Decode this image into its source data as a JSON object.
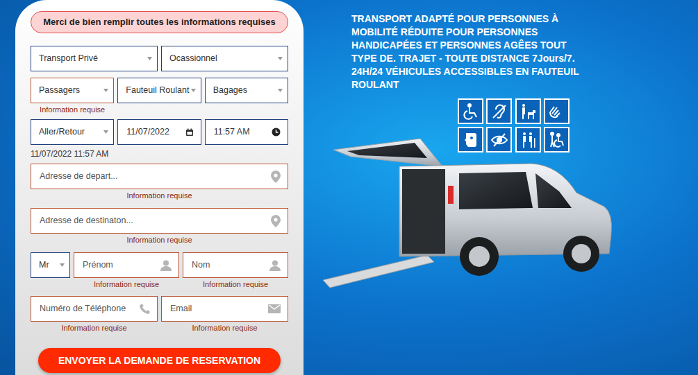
{
  "notice": "Merci de bien remplir toutes les informations requises",
  "form": {
    "rows": [
      {
        "fields": [
          {
            "kind": "select",
            "value": "Transport Privé",
            "error": false
          },
          {
            "kind": "select",
            "value": "Ocassionnel",
            "error": false
          }
        ]
      },
      {
        "fields": [
          {
            "kind": "select",
            "value": "Passagers",
            "error": true,
            "message": "Information requise"
          },
          {
            "kind": "select",
            "value": "Fauteuil Roulant",
            "error": false
          },
          {
            "kind": "select",
            "value": "Bagages",
            "error": false
          }
        ]
      },
      {
        "fields": [
          {
            "kind": "select",
            "value": "Aller/Retour",
            "error": false
          },
          {
            "kind": "date",
            "value": "11/07/2022",
            "error": false
          },
          {
            "kind": "time",
            "value": "11:57 AM",
            "error": false
          }
        ],
        "summary": "11/07/2022 11:57 AM"
      },
      {
        "fields": [
          {
            "kind": "address",
            "placeholder": "Adresse de depart...",
            "error": true,
            "message": "Information requise"
          }
        ]
      },
      {
        "fields": [
          {
            "kind": "address",
            "placeholder": "Adresse de destinaton...",
            "error": true,
            "message": "Information requise"
          }
        ]
      },
      {
        "fields": [
          {
            "kind": "select",
            "value": "Mr",
            "error": false
          },
          {
            "kind": "person",
            "placeholder": "Prénom",
            "error": true,
            "message": "Information requise"
          },
          {
            "kind": "person",
            "placeholder": "Nom",
            "error": true,
            "message": "Information requise"
          }
        ]
      },
      {
        "fields": [
          {
            "kind": "phone",
            "placeholder": "Numéro de Téléphone",
            "error": true,
            "message": "Information requise"
          },
          {
            "kind": "email",
            "placeholder": "Email",
            "error": true,
            "message": "Information requise"
          }
        ]
      }
    ]
  },
  "submit": "ENVOYER LA DEMANDE DE RESERVATION",
  "headline": "TRANSPORT ADAPTÉ POUR PERSONNES À MOBILITÉ RÉDUITE POUR PERSONNES HANDICAPÉES ET PERSONNES AGÊES TOUT TYPE DE. TRAJET - TOUTE DISTANCE 7Jours/7. 24H/24 VÉHICULES ACCESSIBLES EN FAUTEUIL ROULANT"
}
